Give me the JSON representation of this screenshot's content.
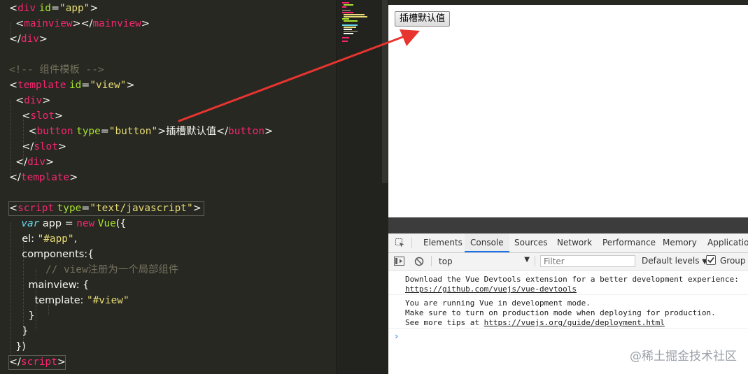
{
  "editor": {
    "lines": [
      {
        "parts": [
          [
            "t-text",
            "<"
          ],
          [
            "t-tag",
            "div"
          ],
          [
            "t-text",
            " "
          ],
          [
            "t-attr",
            "id"
          ],
          [
            "t-text",
            "="
          ],
          [
            "t-str",
            "\"app\""
          ],
          [
            "t-text",
            ">"
          ]
        ]
      },
      {
        "parts": [
          [
            "t-text",
            "  <"
          ],
          [
            "t-tag",
            "mainview"
          ],
          [
            "t-text",
            "></"
          ],
          [
            "t-tag",
            "mainview"
          ],
          [
            "t-text",
            ">"
          ]
        ]
      },
      {
        "parts": [
          [
            "t-text",
            "</"
          ],
          [
            "t-tag",
            "div"
          ],
          [
            "t-text",
            ">"
          ]
        ]
      },
      {
        "parts": []
      },
      {
        "parts": [
          [
            "t-comment",
            "<!-- 组件模板 -->"
          ]
        ]
      },
      {
        "parts": [
          [
            "t-text",
            "<"
          ],
          [
            "t-tag",
            "template"
          ],
          [
            "t-text",
            " "
          ],
          [
            "t-attr",
            "id"
          ],
          [
            "t-text",
            "="
          ],
          [
            "t-str",
            "\"view\""
          ],
          [
            "t-text",
            ">"
          ]
        ]
      },
      {
        "parts": [
          [
            "t-text",
            "  <"
          ],
          [
            "t-tag",
            "div"
          ],
          [
            "t-text",
            ">"
          ]
        ]
      },
      {
        "parts": [
          [
            "t-text",
            "    <"
          ],
          [
            "t-tag",
            "slot"
          ],
          [
            "t-text",
            ">"
          ]
        ]
      },
      {
        "parts": [
          [
            "t-text",
            "      <"
          ],
          [
            "t-tag",
            "button"
          ],
          [
            "t-text",
            " "
          ],
          [
            "t-attr",
            "type"
          ],
          [
            "t-text",
            "="
          ],
          [
            "t-str",
            "\"button\""
          ],
          [
            "t-text",
            ">插槽默认值</"
          ],
          [
            "t-tag",
            "button"
          ],
          [
            "t-text",
            ">"
          ]
        ]
      },
      {
        "parts": [
          [
            "t-text",
            "    </"
          ],
          [
            "t-tag",
            "slot"
          ],
          [
            "t-text",
            ">"
          ]
        ]
      },
      {
        "parts": [
          [
            "t-text",
            "  </"
          ],
          [
            "t-tag",
            "div"
          ],
          [
            "t-text",
            ">"
          ]
        ]
      },
      {
        "parts": [
          [
            "t-text",
            "</"
          ],
          [
            "t-tag",
            "template"
          ],
          [
            "t-text",
            ">"
          ]
        ]
      },
      {
        "parts": []
      },
      {
        "parts": [
          [
            "t-text",
            "<"
          ],
          [
            "t-tag",
            "script"
          ],
          [
            "t-text",
            " "
          ],
          [
            "t-attr",
            "type"
          ],
          [
            "t-text",
            "="
          ],
          [
            "t-str",
            "\"text/javascript\""
          ],
          [
            "t-text",
            ">"
          ]
        ]
      },
      {
        "parts": [
          [
            "t-kw",
            "  var"
          ],
          [
            "t-text",
            " app = "
          ],
          [
            "t-new",
            "new"
          ],
          [
            "t-text",
            " "
          ],
          [
            "t-cls",
            "Vue"
          ],
          [
            "t-text",
            "({"
          ]
        ]
      },
      {
        "parts": [
          [
            "t-text",
            "    el: "
          ],
          [
            "t-str",
            "\"#app\""
          ],
          [
            "t-text",
            ","
          ]
        ]
      },
      {
        "parts": [
          [
            "t-text",
            "    components:{"
          ]
        ]
      },
      {
        "parts": [
          [
            "t-comment",
            "      // view注册为一个局部组件"
          ]
        ]
      },
      {
        "parts": [
          [
            "t-text",
            "      mainview: {"
          ]
        ]
      },
      {
        "parts": [
          [
            "t-text",
            "        template: "
          ],
          [
            "t-str",
            "\"#view\""
          ]
        ]
      },
      {
        "parts": [
          [
            "t-text",
            "      }"
          ]
        ]
      },
      {
        "parts": [
          [
            "t-text",
            "    }"
          ]
        ]
      },
      {
        "parts": [
          [
            "t-text",
            "  })"
          ]
        ]
      },
      {
        "parts": [
          [
            "t-text",
            "</"
          ],
          [
            "t-tag",
            "script"
          ],
          [
            "t-text",
            ">"
          ]
        ]
      }
    ]
  },
  "page": {
    "button_label": "插槽默认值"
  },
  "devtools": {
    "tabs": [
      "Elements",
      "Console",
      "Sources",
      "Network",
      "Performance",
      "Memory",
      "Application"
    ],
    "active_tab": "Console",
    "context_value": "top",
    "filter_placeholder": "Filter",
    "levels_label": "Default levels",
    "group_label": "Group s",
    "messages": [
      {
        "lines": [
          "Download the Vue Devtools extension for a better development experience:"
        ],
        "link": "https://github.com/vuejs/vue-devtools"
      },
      {
        "lines": [
          "You are running Vue in development mode.",
          "Make sure to turn on production mode when deploying for production."
        ],
        "prefix": "See more tips at ",
        "link": "https://vuejs.org/guide/deployment.html"
      }
    ],
    "prompt_symbol": "›"
  },
  "watermark": "@稀土掘金技术社区",
  "colors": {
    "editor_bg": "#272822",
    "tag": "#f92672",
    "attr": "#a6e22e",
    "string": "#e6db74",
    "comment": "#75715e",
    "keyword": "#66d9ef",
    "arrow": "#e8342f",
    "devtools_accent": "#1a73e8"
  }
}
